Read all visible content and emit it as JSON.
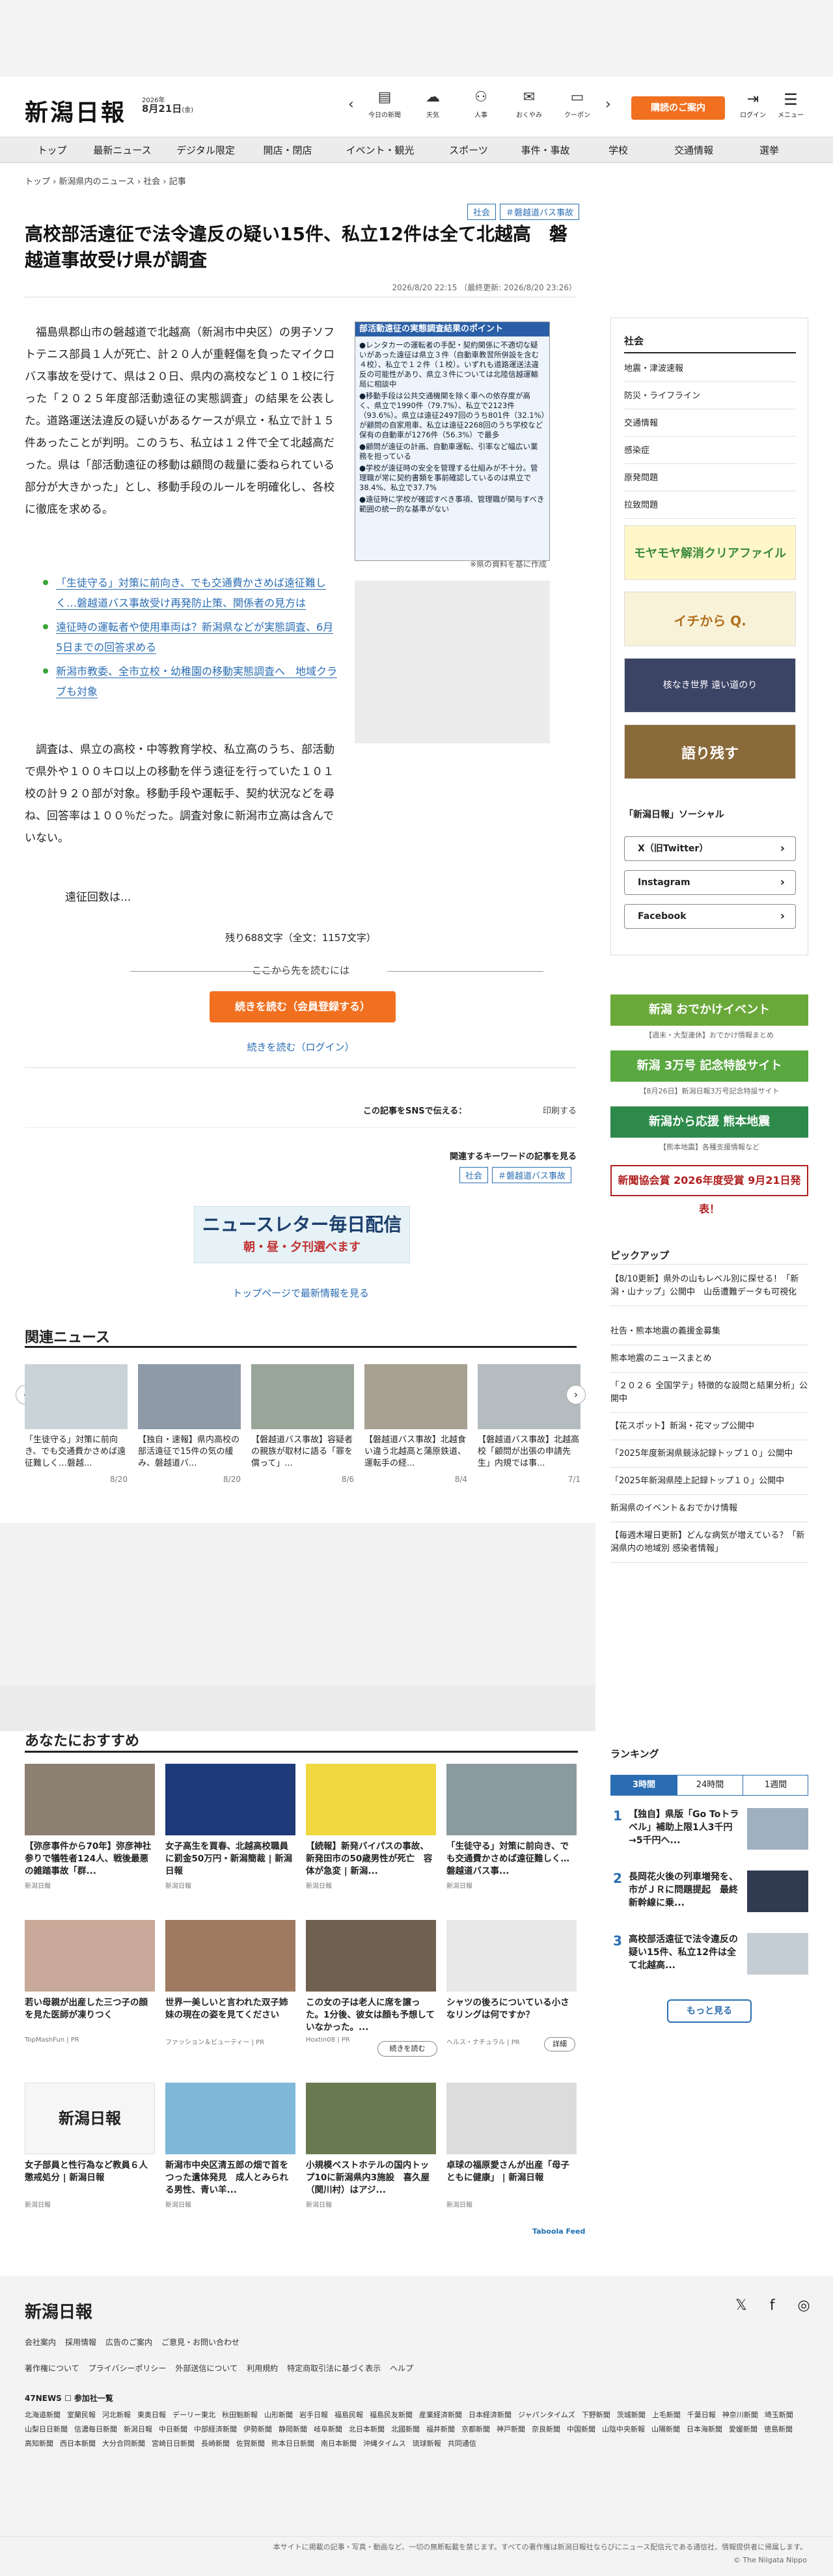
{
  "header": {
    "logo": "新潟日報",
    "date_year": "2026年",
    "date_day": "8月21日",
    "date_weekday": "(金)",
    "icons": [
      {
        "label": "今日の新聞",
        "icon": "newspaper-icon",
        "glyph": "▤"
      },
      {
        "label": "天気",
        "icon": "weather-icon",
        "glyph": "☁"
      },
      {
        "label": "人事",
        "icon": "people-icon",
        "glyph": "👥"
      },
      {
        "label": "おくやみ",
        "icon": "condolence-icon",
        "glyph": "✉"
      },
      {
        "label": "クーポン",
        "icon": "coupon-icon",
        "glyph": "🎟"
      }
    ],
    "signup": "購読のご案内",
    "login": "ログイン",
    "menu": "メニュー"
  },
  "nav": [
    "トップ",
    "最新ニュース",
    "デジタル限定",
    "開店・閉店",
    "イベント・観光",
    "スポーツ",
    "事件・事故",
    "学校",
    "交通情報",
    "選挙"
  ],
  "breadcrumb": "トップ › 新潟県内のニュース › 社会 › 記事",
  "article": {
    "tags": [
      "社会",
      "＃磐越道バス事故"
    ],
    "title": "高校部活遠征で法令違反の疑い15件、私立12件は全て北越高　磐越道事故受け県が調査",
    "date": "2026/8/20 22:15 （最終更新: 2026/8/20 23:26）",
    "body1": "　福島県郡山市の磐越道で北越高（新潟市中央区）の男子ソフトテニス部員１人が死亡、計２０人が重軽傷を負ったマイクロバス事故を受けて、県は２０日、県内の高校など１０１校に行った「２０２５年度部活動遠征の実態調査」の結果を公表した。道路運送法違反の疑いがあるケースが県立・私立で計１５件あったことが判明。このうち、私立は１２件で全て北越高だった。県は「部活動遠征の移動は顧問の裁量に委ねられている部分が大きかった」とし、移動手段のルールを明確化し、各校に徹底を求める。",
    "figure": {
      "title": "部活動遠征の実態調査結果のポイント",
      "items": [
        "●レンタカーの運転者の手配・契約関係に不適切な疑いがあった遠征は県立３件（自動車教習所併設を含む４校）、私立で１２件（１校）。いずれも道路運送法違反の可能性があり、県立３件については北陸信越運輸局に相談中",
        "●移動手段は公共交通機関を除く車への依存度が高く、県立で1990件（79.7%）、私立で2123件（93.6%）。県立は遠征2497回のうち801件（32.1%）が顧問の自家用車、私立は遠征2268回のうち学校など保有の自動車が1276件（56.3%）で最多",
        "●顧問が遠征の計画、自動車運転、引率など幅広い業務を担っている",
        "●学校が遠征時の安全を管理する仕組みが不十分。管理職が常に契約書類を事前確認しているのは県立で38.4%、私立で37.7%",
        "●遠征時に学校が確認すべき事項、管理職が関与すべき範囲の統一的な基準がない"
      ],
      "caption": "※県の資料を基に作成"
    },
    "links": [
      "「生徒守る」対策に前向き、でも交通費かさめば遠征難しく…磐越道バス事故受け再発防止策、関係者の見方は",
      "遠征時の運転者や使用車両は？新潟県などが実態調査、6月5日までの回答求める",
      "新潟市教委、全市立校・幼稚園の移動実態調査へ　地域クラブも対象"
    ],
    "body2": "　調査は、県立の高校・中等教育学校、私立高のうち、部活動で県外や１００キロ以上の移動を伴う遠征を行っていた１０１校の計９２０部が対象。移動手段や運転手、契約状況などを尋ね、回答率は１００％だった。調査対象に新潟市立高は含んでいない。",
    "body3": "遠征回数は...",
    "remaining": "残り688文字（全文：1157文字）",
    "from_here": "ここから先を読むには",
    "read_button": "続きを読む（会員登録する）",
    "read_login": "続きを読む（ログイン）",
    "sns_label": "この記事をSNSで伝える：",
    "sns_print": "印刷する",
    "keywords_label": "関連するキーワードの記事を見る",
    "newsletter_title": "ニュースレター毎日配信",
    "newsletter_sub": "朝・昼・夕刊選べます",
    "top_link": "トップページで最新情報を見る"
  },
  "related": {
    "heading": "関連ニュース",
    "items": [
      {
        "title": "「生徒守る」対策に前向き、でも交通費かさめば遠征難しく…磐越...",
        "date": "8/20"
      },
      {
        "title": "【独自・速報】県内高校の部活遠征で15件の気の緩み、磐越道バ...",
        "date": "8/20"
      },
      {
        "title": "【磐越道バス事故】容疑者の親族が取材に語る「罪を償って」...",
        "date": "8/6"
      },
      {
        "title": "【磐越道バス事故】北越食い違う北越高と蒲原鉄道、運転手の経...",
        "date": "8/4"
      },
      {
        "title": "【磐越道バス事故】北越高校「顧問が出張の申請先生」内規では事...",
        "date": "7/1"
      }
    ]
  },
  "sidebar": {
    "heading": "社会",
    "items": [
      "地震・津波速報",
      "防災・ライフライン",
      "交通情報",
      "感染症",
      "原発問題",
      "拉致問題"
    ],
    "banners": [
      "モヤモヤ解消クリアファイル",
      "イチから Q.",
      "核なき世界 遠い道のり",
      "語り残す"
    ],
    "social_heading": "「新潟日報」ソーシャル",
    "social": [
      "X（旧Twitter）",
      "Instagram",
      "Facebook"
    ],
    "banners2": [
      {
        "label": "新潟 おでかけイベント",
        "caption": "【週末・大型連休】おでかけ情報まとめ"
      },
      {
        "label": "新潟 3万号 記念特設サイト",
        "caption": "【8月26日】新潟日報3万号記念特設サイト"
      },
      {
        "label": "新潟から応援 熊本地震",
        "caption": "【熊本地震】各種支援情報など"
      },
      {
        "label": "新聞協会賞 2026年度受賞 9月21日発表！",
        "caption": ""
      }
    ],
    "pickup_heading": "ピックアップ",
    "pickup": [
      "【8/10更新】県外の山もレベル別に探せる！「新潟・山ナップ」公開中　山岳遭難データも可視化",
      "社告・熊本地震の義援金募集",
      "熊本地震のニュースまとめ",
      "「２０２６ 全国学テ」特徴的な設問と結果分析」公開中",
      "【花スポット】新潟・花マップ公開中",
      "「2025年度新潟県競泳記録トップ１０」公開中",
      "「2025年新潟県陸上記録トップ１０」公開中",
      "新潟県のイベント＆おでかけ情報",
      "【毎週木曜日更新】どんな病気が増えている？「新潟県内の地域別 感染者情報」"
    ]
  },
  "recommend": {
    "heading": "あなたにおすすめ",
    "items": [
      {
        "title": "【弥彦事件から70年】弥彦神社参りで犠牲者124人、戦後最悪の雑踏事故「群...",
        "source": "新潟日報"
      },
      {
        "title": "女子高生を買春、北越高校職員に罰金50万円・新潟簡裁 | 新潟日報",
        "source": "新潟日報"
      },
      {
        "title": "【続報】新発バイパスの事故、新発田市の50歳男性が死亡　容体が急変 | 新潟...",
        "source": "新潟日報"
      },
      {
        "title": "「生徒守る」対策に前向き、でも交通費かさめば遠征難しく…磐越道バス事...",
        "source": "新潟日報"
      },
      {
        "title": "若い母親が出産した三つ子の顔を見た医師が凍りつく",
        "source": "TopMashFun | PR"
      },
      {
        "title": "世界一美しいと言われた双子姉妹の現在の姿を見てください",
        "source": "ファッション＆ビューティー | PR"
      },
      {
        "title": "この女の子は老人に席を譲った。1分後、彼女は顔も予想していなかった。...",
        "source": "Hoxtin08 | PR"
      },
      {
        "title": "シャツの後ろについている小さなリングは何ですか？",
        "source": "ヘルス・ナチュラル | PR"
      },
      {
        "title": "女子部員と性行為など教員６人懲戒処分 | 新潟日報",
        "source": "新潟日報"
      },
      {
        "title": "新潟市中央区清五郎の畑で首をつった遺体発見　成人とみられる男性、青い羊...",
        "source": "新潟日報"
      },
      {
        "title": "小規模ベストホテルの国内トップ10に新潟県内3施設　喜久屋（関川村）はアジ...",
        "source": "新潟日報"
      },
      {
        "title": "卓球の福原愛さんが出産「母子ともに健康」 | 新潟日報",
        "source": "新潟日報"
      }
    ],
    "cta_continue": "続きを読む",
    "cta_detail": "詳細",
    "taboola": "Taboola Feed"
  },
  "ranking": {
    "heading": "ランキング",
    "tabs": [
      "3時間",
      "24時間",
      "1週間"
    ],
    "items": [
      {
        "rank": "1",
        "title": "【独自】県版「Go Toトラベル」補助上限1人3千円→5千円へ..."
      },
      {
        "rank": "2",
        "title": "長岡花火後の列車増発を、市がＪＲに問題提起　最終新幹線に乗..."
      },
      {
        "rank": "3",
        "title": "高校部活遠征で法令違反の疑い15件、私立12件は全て北越高..."
      }
    ],
    "more": "もっと見る"
  },
  "footer": {
    "logo": "新潟日報",
    "social": "𝕏 f ◎",
    "links1": [
      "会社案内",
      "採用情報",
      "広告のご案内",
      "ご意見・お問い合わせ"
    ],
    "links2": [
      "著作権について",
      "プライバシーポリシー",
      "外部送信について",
      "利用規約",
      "特定商取引法に基づく表示",
      "ヘルプ"
    ],
    "news47": "47NEWS ☐ 参加社一覧",
    "papers": [
      "北海道新聞",
      "室蘭民報",
      "河北新報",
      "東奥日報",
      "デーリー東北",
      "秋田魁新報",
      "山形新聞",
      "岩手日報",
      "福島民報",
      "福島民友新聞",
      "産業経済新聞",
      "日本経済新聞",
      "ジャパンタイムズ",
      "下野新聞",
      "茨城新聞",
      "上毛新聞",
      "千葉日報",
      "神奈川新聞",
      "埼玉新聞",
      "山梨日日新聞",
      "信濃毎日新聞",
      "新潟日報",
      "中日新聞",
      "中部経済新聞",
      "伊勢新聞",
      "静岡新聞",
      "岐阜新聞",
      "北日本新聞",
      "北國新聞",
      "福井新聞",
      "京都新聞",
      "神戸新聞",
      "奈良新聞",
      "中国新聞",
      "山陰中央新報",
      "山陽新聞",
      "日本海新聞",
      "愛媛新聞",
      "徳島新聞",
      "高知新聞",
      "西日本新聞",
      "大分合同新聞",
      "宮崎日日新聞",
      "長崎新聞",
      "佐賀新聞",
      "熊本日日新聞",
      "南日本新聞",
      "沖縄タイムス",
      "琉球新報",
      "共同通信"
    ],
    "copyright1": "本サイトに掲載の記事・写真・動画など、一切の無断転載を禁じます。すべての著作権は新潟日報社ならびにニュース配信元である通信社、情報提供者に帰属します。",
    "copyright2": "© The Niigata Nippo"
  }
}
